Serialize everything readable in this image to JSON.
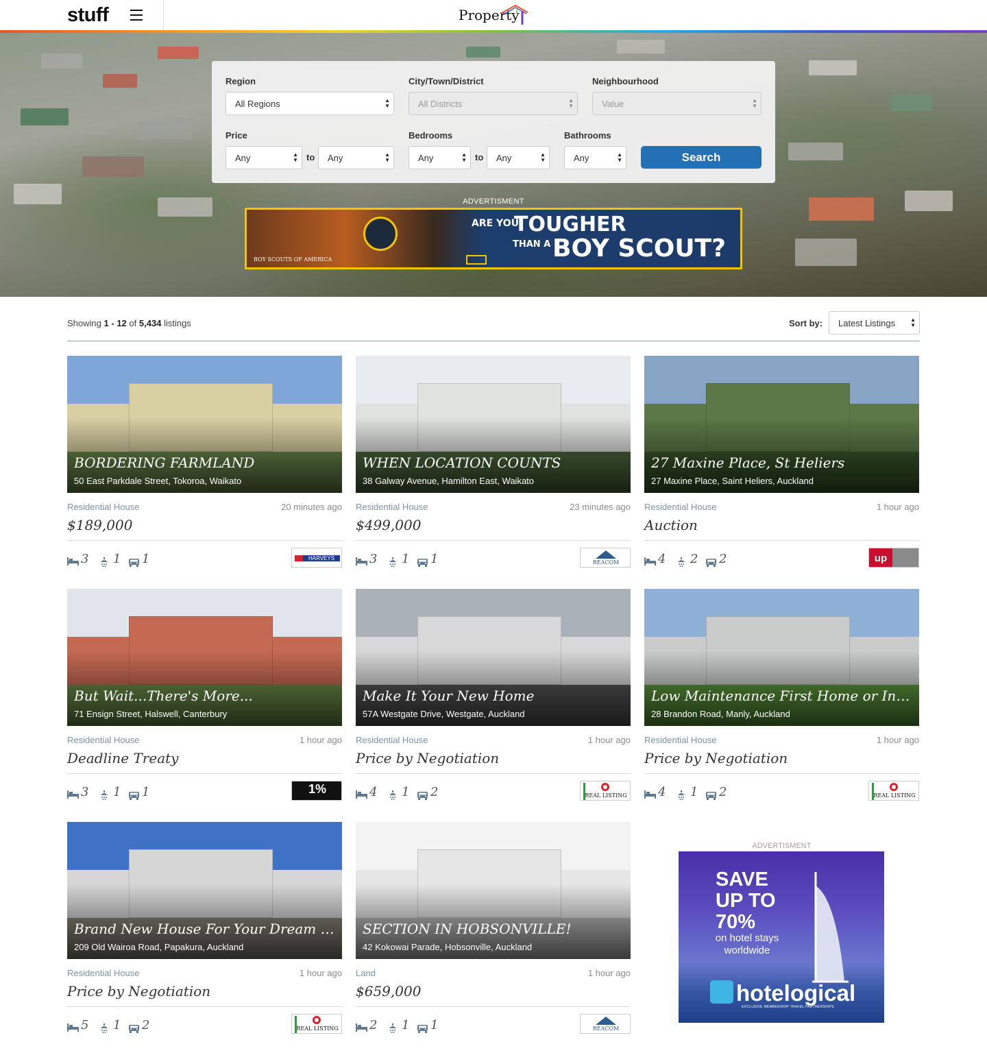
{
  "header": {
    "stuff_logo": "stuff",
    "property_logo": "Property"
  },
  "search": {
    "region": {
      "label": "Region",
      "value": "All Regions"
    },
    "district": {
      "label": "City/Town/District",
      "value": "All Districts"
    },
    "neighbourhood": {
      "label": "Neighbourhood",
      "value": "Value"
    },
    "price": {
      "label": "Price",
      "min": "Any",
      "max": "Any",
      "to": "to"
    },
    "bedrooms": {
      "label": "Bedrooms",
      "min": "Any",
      "max": "Any",
      "to": "to"
    },
    "bathrooms": {
      "label": "Bathrooms",
      "value": "Any"
    },
    "button": "Search"
  },
  "hero_ad": {
    "label": "ADVERTISMENT",
    "headline_small": "ARE YOU",
    "headline_big1": "TOUGHER",
    "headline_small2": "THAN A",
    "headline_big2": "BOY SCOUT?",
    "sponsor": "BOY SCOUTS OF AMERICA"
  },
  "listing_bar": {
    "showing_prefix": "Showing",
    "range_start": "1",
    "range_sep": "-",
    "range_end": "12",
    "of": "of",
    "total": "5,434",
    "suffix": "listings",
    "sort_label": "Sort by:",
    "sort_value": "Latest Listings"
  },
  "listings": [
    {
      "title": "BORDERING FARMLAND",
      "address": "50 East Parkdale Street, Tokoroa, Waikato",
      "type": "Residential House",
      "time": "20 minutes ago",
      "price": "$189,000",
      "beds": "3",
      "baths": "1",
      "cars": "1",
      "agent": "HARVEYS"
    },
    {
      "title": "WHEN LOCATION COUNTS",
      "address": "38 Galway Avenue, Hamilton East, Waikato",
      "type": "Residential House",
      "time": "23 minutes ago",
      "price": "$499,000",
      "beds": "3",
      "baths": "1",
      "cars": "1",
      "agent": "REACOM"
    },
    {
      "title": "27 Maxine Place, St Heliers",
      "address": "27 Maxine Place, Saint Heliers, Auckland",
      "type": "Residential House",
      "time": "1 hour ago",
      "price": "Auction",
      "beds": "4",
      "baths": "2",
      "cars": "2",
      "agent": "up"
    },
    {
      "title": "But Wait...There's More...",
      "address": "71 Ensign Street, Halswell, Canterbury",
      "type": "Residential House",
      "time": "1 hour ago",
      "price": "Deadline Treaty",
      "beds": "3",
      "baths": "1",
      "cars": "1",
      "agent": "1%"
    },
    {
      "title": "Make It Your New Home",
      "address": "57A Westgate Drive, Westgate, Auckland",
      "type": "Residential House",
      "time": "1 hour ago",
      "price": "Price by Negotiation",
      "beds": "4",
      "baths": "1",
      "cars": "2",
      "agent": "REAL LISTING"
    },
    {
      "title": "Low Maintenance First Home or Inves...",
      "address": "28 Brandon Road, Manly, Auckland",
      "type": "Residential House",
      "time": "1 hour ago",
      "price": "Price by Negotiation",
      "beds": "4",
      "baths": "1",
      "cars": "2",
      "agent": "REAL LISTING"
    },
    {
      "title": "Brand New House For Your Dream Home",
      "address": "209 Old Wairoa Road, Papakura, Auckland",
      "type": "Residential House",
      "time": "1 hour ago",
      "price": "Price by Negotiation",
      "beds": "5",
      "baths": "1",
      "cars": "2",
      "agent": "REAL LISTING"
    },
    {
      "title": "SECTION IN HOBSONVILLE!",
      "address": "42 Kokowai Parade, Hobsonville, Auckland",
      "type": "Land",
      "time": "1 hour ago",
      "price": "$659,000",
      "beds": "2",
      "baths": "1",
      "cars": "1",
      "agent": "REACOM"
    }
  ],
  "side_ad": {
    "label": "ADVERTISMENT",
    "line1": "SAVE",
    "line2": "UP TO",
    "line3": "70%",
    "sub": "on hotel stays worldwide",
    "brand": "hotelogical",
    "tagline": "EXCLUSIVE MEMBERSHIP TRAVEL PARTNERSHIPS"
  },
  "colors": {
    "search_button": "#2470b5",
    "meta_text": "#7b93a6",
    "ad_border": "#f5c400"
  },
  "icons": [
    "menu-icon",
    "bed-icon",
    "shower-icon",
    "car-icon",
    "select-arrows-icon"
  ]
}
